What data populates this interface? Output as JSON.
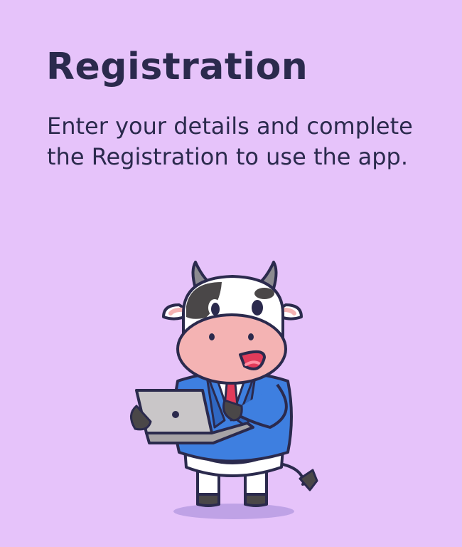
{
  "screen": {
    "title": "Registration",
    "description": "Enter your details and complete the Registration to use the app."
  },
  "illustration": {
    "icon": "cow-with-laptop-illustration"
  },
  "colors": {
    "background": "#E6C3FA",
    "text": "#2B2A4D",
    "suit": "#3E7FE0",
    "snout": "#F4B3B3"
  }
}
